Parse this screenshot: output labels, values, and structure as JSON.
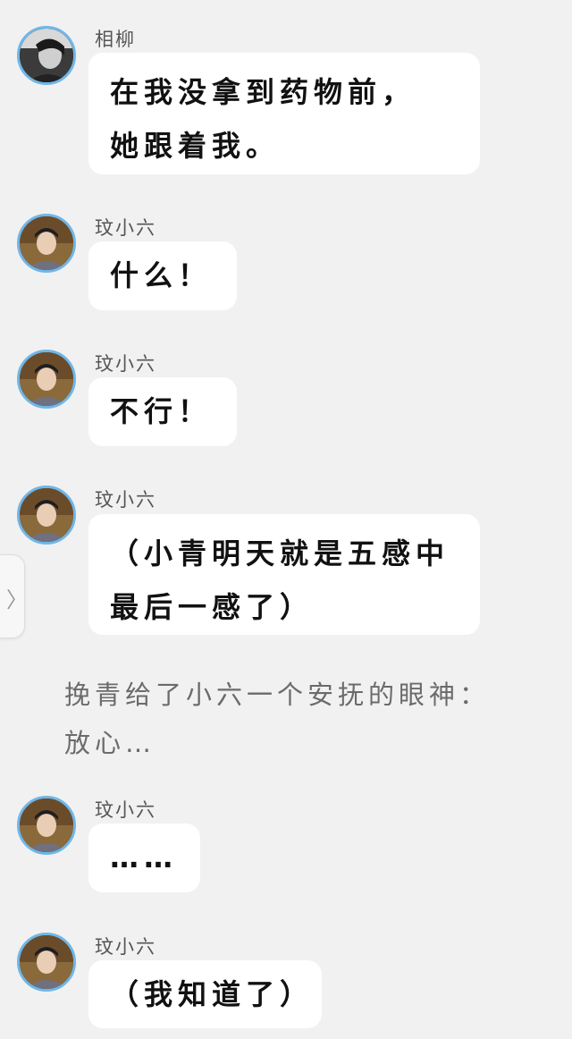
{
  "messages": [
    {
      "sender": "相柳",
      "text": "在我没拿到药物前，\n她跟着我。",
      "avatar": "xiangliu-avatar"
    },
    {
      "sender": "玟小六",
      "text": "什么！",
      "avatar": "wenxiaoliu-avatar"
    },
    {
      "sender": "玟小六",
      "text": "不行！",
      "avatar": "wenxiaoliu-avatar"
    },
    {
      "sender": "玟小六",
      "text": "（小青明天就是五感中\n最后一感了）",
      "avatar": "wenxiaoliu-avatar"
    },
    {
      "sender": "玟小六",
      "text": "……",
      "avatar": "wenxiaoliu-avatar"
    },
    {
      "sender": "玟小六",
      "text": "（我知道了）",
      "avatar": "wenxiaoliu-avatar"
    }
  ],
  "narration": "挽青给了小六一个安抚的眼神：\n放心…",
  "side_tab": {
    "icon": "chevron-right-icon",
    "glyph": "〉"
  },
  "colors": {
    "background": "#f1f1f1",
    "bubble": "#ffffff",
    "avatar_ring": "#6fb6e8"
  }
}
